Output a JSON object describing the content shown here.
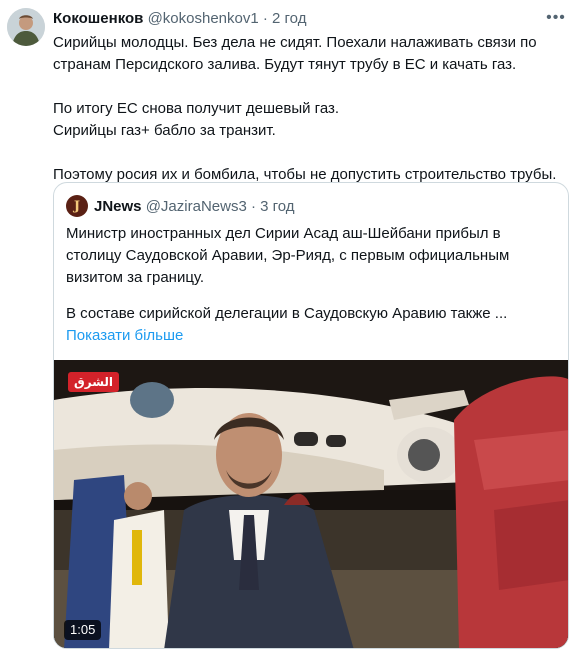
{
  "tweet": {
    "author_name": "Кокошенков",
    "handle": "@kokoshenkov1",
    "separator": "·",
    "time": "2 год",
    "more_icon": "more-horizontal-icon",
    "paragraphs": [
      "Сирийцы молодцы. Без дела не сидят. Поехали налаживать связи по странам Персидского залива. Будут тянут трубу в ЕС и качать газ.",
      "По итогу ЕС снова получит дешевый газ.\nСирийцы газ+ бабло за транзит.",
      "Поэтому росия их и бомбила, чтобы не допустить строительство трубы."
    ]
  },
  "quote": {
    "avatar_letter": "J",
    "author_name": "JNews",
    "handle": "@JaziraNews3",
    "separator": "·",
    "time": "3 год",
    "paragraphs": [
      "Министр иностранных дел Сирии Асад аш-Шейбани прибыл в столицу Саудовской Аравии, Эр-Рияд, с первым официальным визитом за границу.",
      "В составе сирийской делегации в Саудовскую Аравию также ..."
    ],
    "show_more": "Показати більше",
    "video": {
      "duration": "1:05",
      "channel_logo": "الشرق"
    }
  }
}
